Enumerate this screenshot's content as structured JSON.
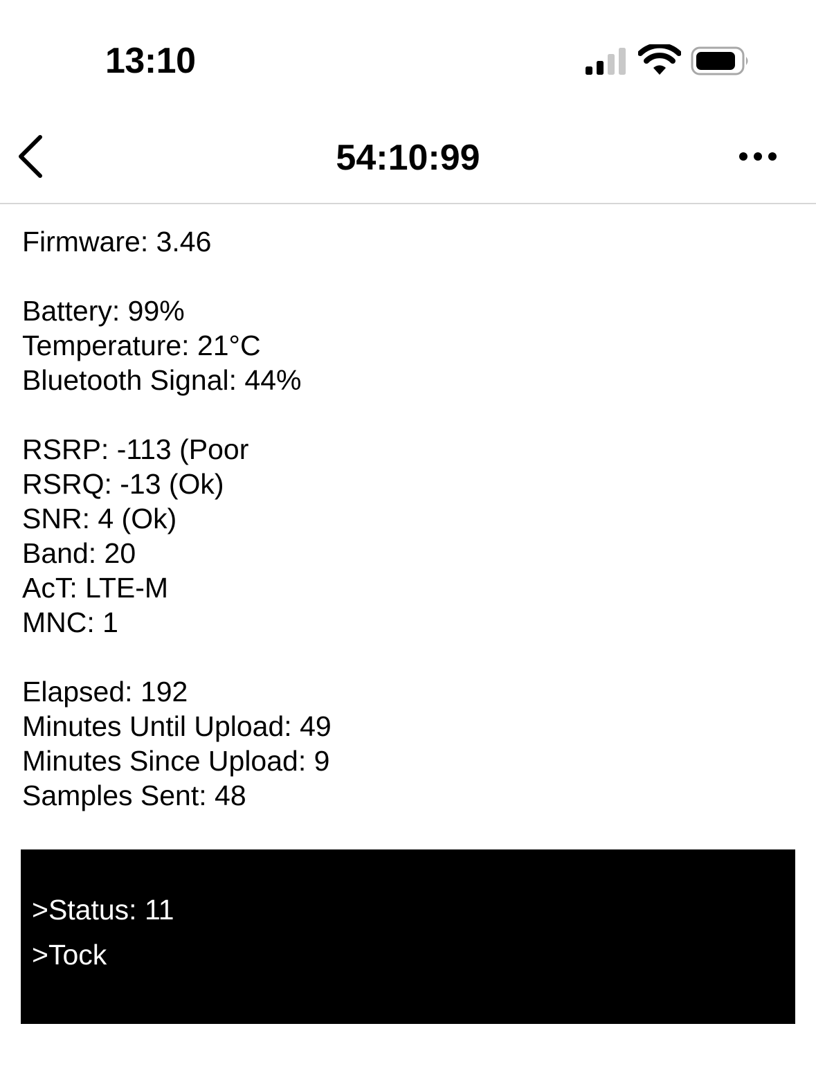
{
  "status_bar": {
    "time": "13:10",
    "cell_signal_icon": "cellular-signal-icon",
    "wifi_icon": "wifi-icon",
    "battery_icon": "battery-icon"
  },
  "nav": {
    "title": "54:10:99",
    "back_icon": "chevron-left-icon",
    "more_icon": "ellipsis-icon"
  },
  "info": {
    "firmware": "Firmware: 3.46",
    "battery": "Battery: 99%",
    "temperature": "Temperature: 21°C",
    "bluetooth_signal": "Bluetooth Signal: 44%",
    "rsrp": "RSRP: -113 (Poor",
    "rsrq": "RSRQ: -13 (Ok)",
    "snr": "SNR: 4 (Ok)",
    "band": "Band: 20",
    "act": "AcT: LTE-M",
    "mnc": "MNC: 1",
    "elapsed": "Elapsed: 192",
    "minutes_until_upload": "Minutes Until Upload: 49",
    "minutes_since_upload": "Minutes Since Upload: 9",
    "samples_sent": "Samples Sent: 48"
  },
  "console": {
    "lines": [
      ">Status: 11",
      ">Tock"
    ],
    "background": "#000000",
    "text_color": "#ffffff"
  }
}
